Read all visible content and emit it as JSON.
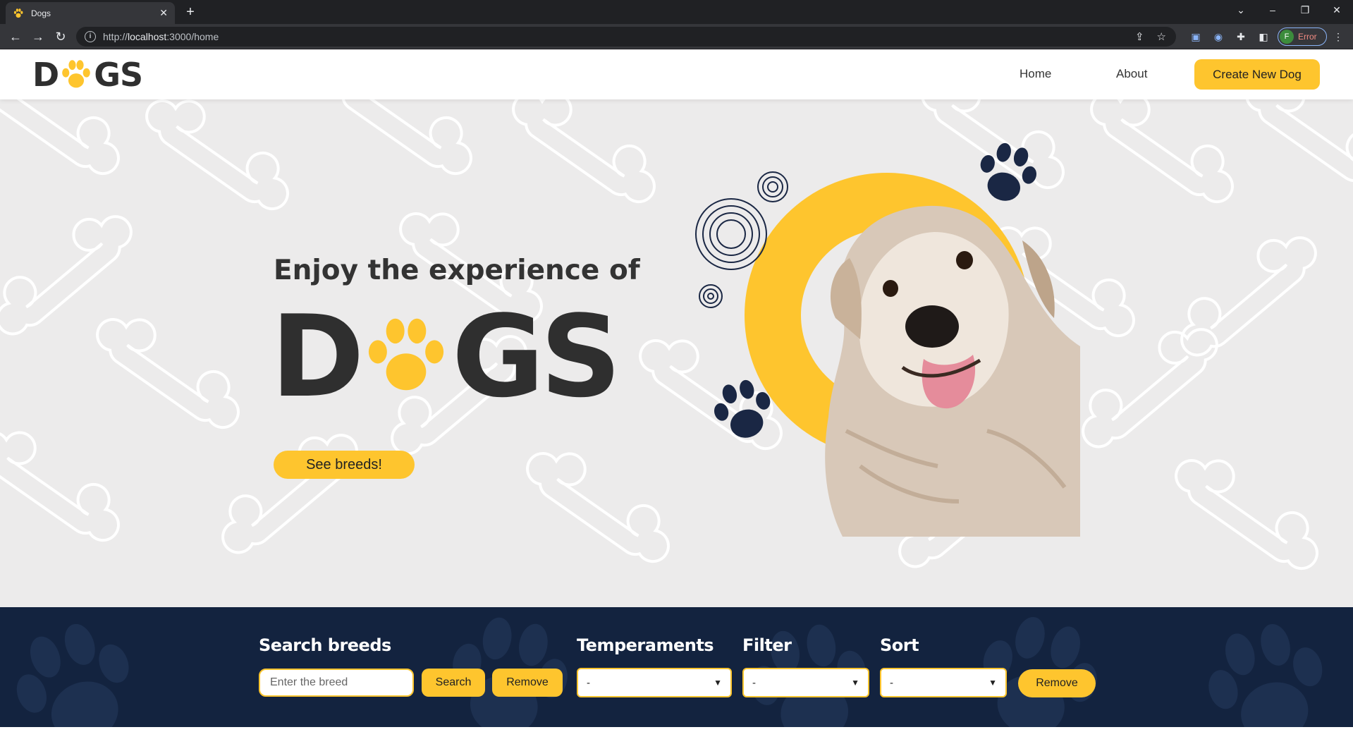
{
  "browser": {
    "tab_title": "Dogs",
    "url_prefix": "http://",
    "url_host": "localhost",
    "url_path": ":3000/home",
    "profile_initial": "F",
    "profile_status": "Error"
  },
  "header": {
    "logo_left": "D",
    "logo_right": "GS",
    "nav": [
      "Home",
      "About"
    ],
    "create_button": "Create New Dog"
  },
  "hero": {
    "subtitle": "Enjoy the experience of",
    "title_left": "D",
    "title_right": "GS",
    "cta": "See breeds!"
  },
  "filters": {
    "search_label": "Search breeds",
    "search_placeholder": "Enter the breed",
    "search_button": "Search",
    "remove_button": "Remove",
    "temperaments_label": "Temperaments",
    "temperaments_value": "-",
    "filter_label": "Filter",
    "filter_value": "-",
    "sort_label": "Sort",
    "sort_value": "-",
    "remove_all_button": "Remove"
  },
  "colors": {
    "accent": "#fec52e",
    "navy": "#13233f",
    "text_dark": "#2f2f2f"
  }
}
